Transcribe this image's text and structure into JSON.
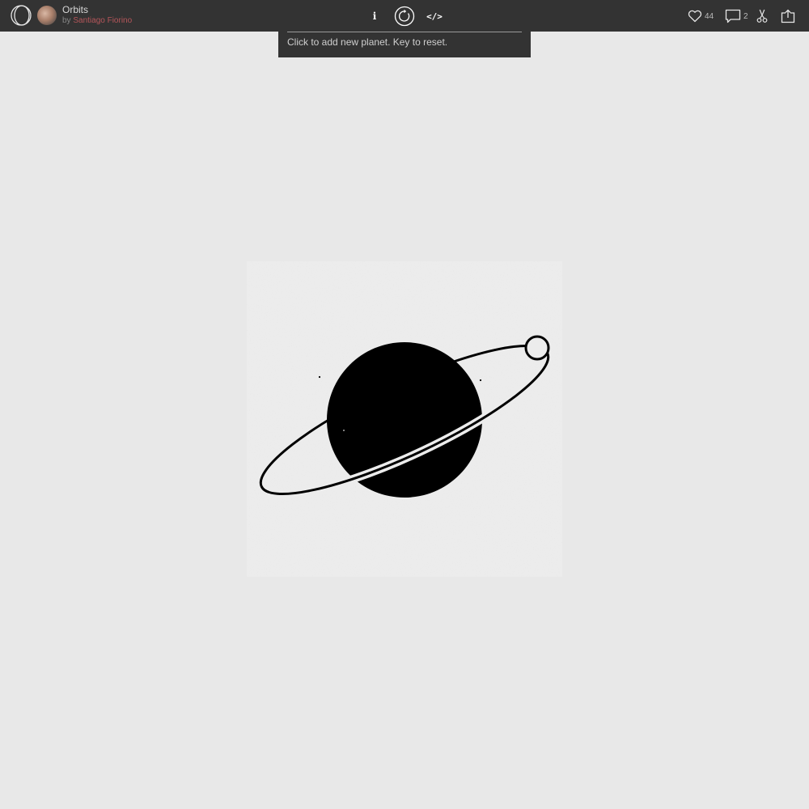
{
  "app": {
    "logo_icon": "openprocessing-logo-icon",
    "sketch_title": "Orbits",
    "byline_prefix": "by",
    "author": "Santiago Fiorino"
  },
  "toolbar": {
    "info_label": "i",
    "restart_icon": "restart-icon",
    "code_label": "</>"
  },
  "stats": {
    "likes": "44",
    "comments": "2",
    "fork_icon": "fork-icon",
    "share_icon": "share-icon"
  },
  "info_panel": {
    "text": "Click to add new planet. Key to reset."
  },
  "colors": {
    "topbar": "#333333",
    "background": "#e8e8e8",
    "author_link": "#b5565a",
    "planet": "#000000"
  }
}
